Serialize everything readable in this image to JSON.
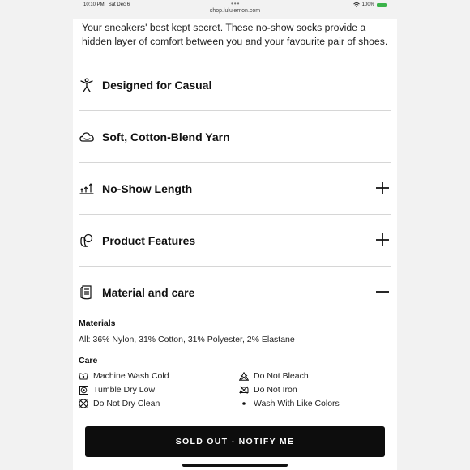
{
  "status": {
    "time": "10:10 PM",
    "date": "Sat Dec 6",
    "battery": "100%"
  },
  "browser": {
    "url": "shop.lululemon.com"
  },
  "intro": "Your sneakers' best kept secret. These no-show socks provide a hidden layer of comfort between you and your favourite pair of shoes.",
  "features": [
    {
      "label": "Designed for Casual",
      "icon": "person-stretch-icon"
    },
    {
      "label": "Soft, Cotton-Blend Yarn",
      "icon": "cloud-icon"
    },
    {
      "label": "No-Show Length",
      "icon": "length-arrows-icon",
      "expandable": true
    },
    {
      "label": "Product Features",
      "icon": "features-icon",
      "expandable": true
    },
    {
      "label": "Material and care",
      "icon": "care-label-icon",
      "expanded": true
    }
  ],
  "materials": {
    "title": "Materials",
    "text": "All: 36% Nylon, 31% Cotton, 31% Polyester, 2% Elastane"
  },
  "care": {
    "title": "Care",
    "items": [
      {
        "label": "Machine Wash Cold",
        "icon": "wash-tub-icon"
      },
      {
        "label": "Do Not Bleach",
        "icon": "no-bleach-icon"
      },
      {
        "label": "Tumble Dry Low",
        "icon": "tumble-dry-icon"
      },
      {
        "label": "Do Not Iron",
        "icon": "no-iron-icon"
      },
      {
        "label": "Do Not Dry Clean",
        "icon": "no-dry-clean-icon"
      },
      {
        "label": "Wash With Like Colors",
        "icon": "bullet-icon"
      }
    ]
  },
  "cta": {
    "label": "SOLD OUT - NOTIFY ME"
  },
  "colors": {
    "battery": "#3bb34a",
    "button": "#0d0d0d",
    "divider": "#d6d6d6"
  }
}
